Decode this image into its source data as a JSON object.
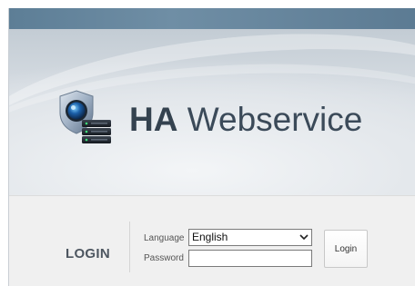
{
  "header": {
    "brand_bold": "HA",
    "brand_rest": " Webservice",
    "logo_icon": "shield-camera-server-icon"
  },
  "login": {
    "title": "LOGIN",
    "language_label": "Language",
    "language_value": "English",
    "password_label": "Password",
    "password_value": "",
    "button_label": "Login"
  },
  "colors": {
    "topbar": "#6f8ea5",
    "brand_text": "#3b4a59",
    "login_panel": "#f0f0f0"
  }
}
